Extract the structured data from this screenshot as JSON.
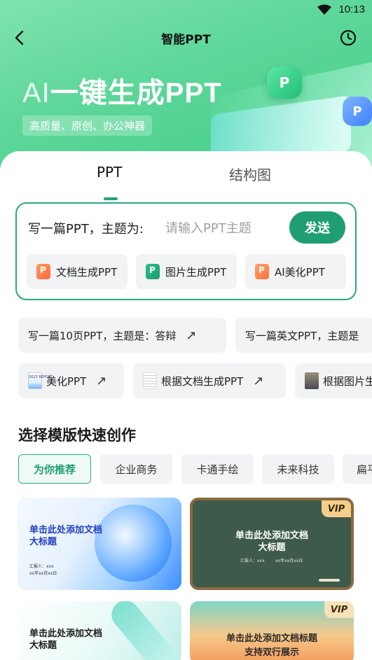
{
  "status_bar": {
    "time": "10:13"
  },
  "nav": {
    "title": "智能PPT"
  },
  "hero": {
    "title_ai": "AI",
    "title_rest": "一键生成PPT",
    "subtitle": "高质量、原创、办公神器",
    "badge_p": "P",
    "badge_share": "P"
  },
  "tabs": [
    {
      "label": "PPT"
    },
    {
      "label": "结构图"
    }
  ],
  "prompt": {
    "prefix": "写一篇PPT，主题为:",
    "placeholder": "请输入PPT主题",
    "send_label": "发送"
  },
  "modes": [
    {
      "label": "文档生成PPT"
    },
    {
      "label": "图片生成PPT"
    },
    {
      "label": "AI美化PPT"
    }
  ],
  "suggestions_row1": [
    {
      "label": "写一篇10页PPT，主题是：答辩"
    },
    {
      "label": "写一篇英文PPT，主题是"
    }
  ],
  "suggestions_row2": [
    {
      "label": "美化PPT",
      "thumb_text": "2023 REPORT"
    },
    {
      "label": "根据文档生成PPT"
    },
    {
      "label": "根据图片生"
    }
  ],
  "section": {
    "title": "选择模版快速创作"
  },
  "categories": [
    {
      "label": "为你推荐"
    },
    {
      "label": "企业商务"
    },
    {
      "label": "卡通手绘"
    },
    {
      "label": "未来科技"
    },
    {
      "label": "扁平"
    }
  ],
  "templates": [
    {
      "title": "单击此处添加文档\n大标题",
      "meta1": "汇报人：xxx",
      "meta2": "xx年xx月xx日"
    },
    {
      "title": "单击此处添加文档\n大标题",
      "meta1": "汇报人：xxx",
      "meta2": "xx年xx月xx日",
      "vip": "VIP"
    },
    {
      "title": "单击此处添加文档\n大标题"
    },
    {
      "title": "单击此处添加文档标题\n支持双行展示",
      "vip": "VIP"
    }
  ]
}
